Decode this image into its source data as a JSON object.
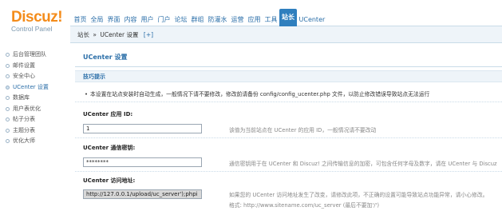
{
  "logo": {
    "title": "Discuz!",
    "subtitle": "Control Panel"
  },
  "nav": {
    "items": [
      {
        "label": "首页"
      },
      {
        "label": "全局"
      },
      {
        "label": "界面"
      },
      {
        "label": "内容"
      },
      {
        "label": "用户"
      },
      {
        "label": "门户"
      },
      {
        "label": "论坛"
      },
      {
        "label": "群组"
      },
      {
        "label": "防灌水"
      },
      {
        "label": "运营"
      },
      {
        "label": "应用"
      },
      {
        "label": "工具"
      },
      {
        "label": "站长"
      },
      {
        "label": "UCenter"
      }
    ],
    "active": "站长"
  },
  "sidebar": {
    "items": [
      {
        "label": "后台管理团队"
      },
      {
        "label": "邮件设置"
      },
      {
        "label": "安全中心"
      },
      {
        "label": "UCenter 设置"
      },
      {
        "label": "数据库"
      },
      {
        "label": "用户表优化"
      },
      {
        "label": "帖子分表"
      },
      {
        "label": "主题分表"
      },
      {
        "label": "优化大师"
      }
    ],
    "active": "UCenter 设置"
  },
  "breadcrumb": {
    "root": "站长",
    "separator": "»",
    "current": "UCenter 设置",
    "add": "[+]"
  },
  "main": {
    "title": "UCenter 设置",
    "tips": {
      "title": "技巧提示",
      "bullet": "•",
      "text": "本设置在站点安装时自动生成，一般情况下请不要修改，修改前请备份 config/config_ucenter.php 文件，以防止修改错误导致站点无法运行"
    },
    "fields": [
      {
        "label": "UCenter 应用 ID:",
        "value": "1",
        "description": "该值为当前站点在 UCenter 的应用 ID，一般情况请不要改动"
      },
      {
        "label": "UCenter 通信密钥:",
        "value": "********",
        "description": "通信密钥用于在 UCenter 和 Discuz! 之间传输信息的加密，可包含任何字母及数字，请在 UCenter 与 Discuz"
      },
      {
        "label": "UCenter 访问地址:",
        "value": "http://127.0.0.1/upload/uc_server');phpi",
        "description": "如果您的 UCenter 访问地址发生了改变，请修改此项，不正确的设置可能导致站点功能异常，请小心修改。",
        "description2": "格式: http://www.sitename.com/uc_server (最后不要加'/')"
      }
    ]
  },
  "colors": {
    "accent": "#2f7fbe",
    "link": "#2a6ea8",
    "logo": "#f48c1b"
  }
}
